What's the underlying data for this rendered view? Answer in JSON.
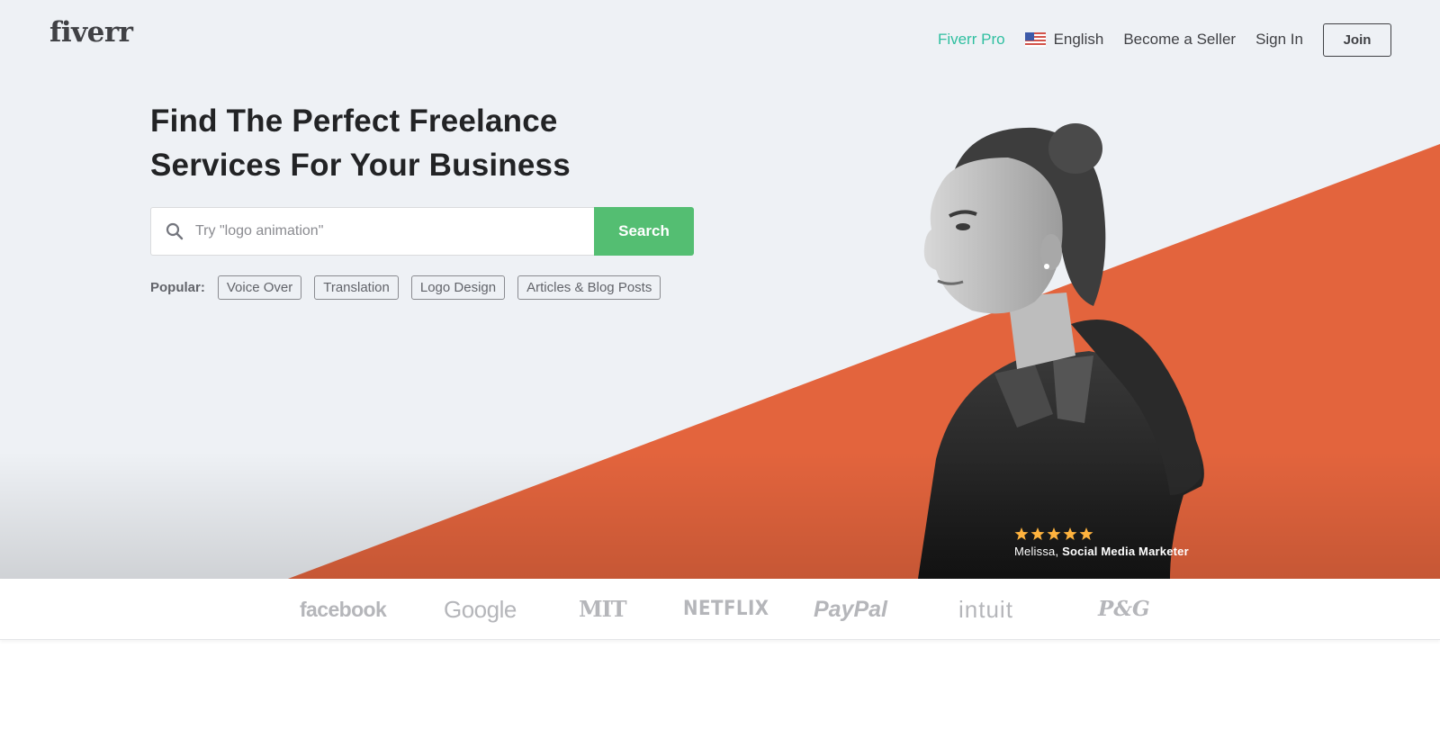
{
  "brand": {
    "logo_text": "fiverr"
  },
  "nav": {
    "pro": "Fiverr Pro",
    "language": "English",
    "become_seller": "Become a Seller",
    "sign_in": "Sign In",
    "join": "Join"
  },
  "hero": {
    "headline_line1": "Find The Perfect Freelance",
    "headline_line2": "Services For Your Business",
    "search": {
      "placeholder": "Try \"logo animation\"",
      "button": "Search"
    },
    "popular": {
      "label": "Popular:",
      "tags": [
        "Voice Over",
        "Translation",
        "Logo Design",
        "Articles & Blog Posts"
      ]
    },
    "testimonial": {
      "rating": 5,
      "name": "Melissa,",
      "role": "Social Media Marketer"
    }
  },
  "trusted_by": {
    "brands": [
      "facebook",
      "Google",
      "MIT",
      "NETFLIX",
      "PayPal",
      "intuit",
      "P&G"
    ]
  },
  "colors": {
    "accent_green": "#54be72",
    "pro_teal": "#2fbfa0",
    "hero_orange": "#e3643d",
    "hero_bg": "#eef1f5",
    "star_gold": "#ffb33e"
  },
  "icons": {
    "search": "search-icon",
    "flag": "us-flag-icon",
    "star": "star-icon"
  }
}
